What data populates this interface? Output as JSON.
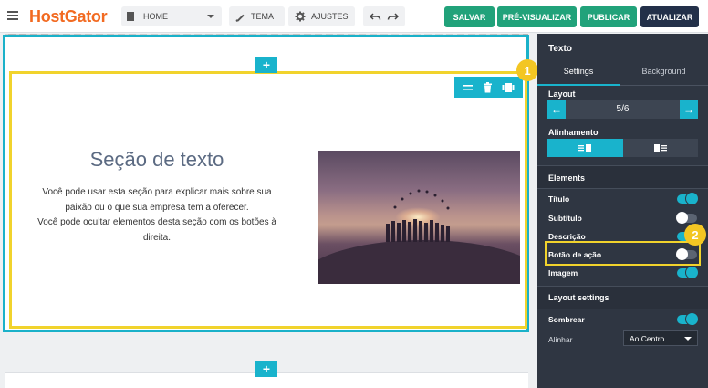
{
  "app": {
    "logo": "HostGator"
  },
  "topbar": {
    "page_select": "HOME",
    "tema_label": "TEMA",
    "ajustes_label": "AJUSTES",
    "salvar_label": "SALVAR",
    "previsualizar_label": "PRÉ-VISUALIZAR",
    "publicar_label": "PUBLICAR",
    "atualizar_label": "ATUALIZAR"
  },
  "section": {
    "title": "Seção de texto",
    "description": [
      "Você pode usar esta seção para explicar mais sobre sua",
      "paixão ou o que sua empresa tem a oferecer.",
      "Você pode ocultar elementos desta seção com os botões à",
      "direita."
    ],
    "add_symbol": "+"
  },
  "badges": {
    "one": "1",
    "two": "2"
  },
  "panel": {
    "title": "Texto",
    "tabs": [
      {
        "label": "Settings",
        "active": true
      },
      {
        "label": "Background",
        "active": false
      }
    ],
    "layout_label": "Layout",
    "layout_value": "5/6",
    "alignment_label": "Alinhamento",
    "elements_header": "Elements",
    "elements": [
      {
        "label": "Título",
        "on": true
      },
      {
        "label": "Subtítulo",
        "on": false
      },
      {
        "label": "Descrição",
        "on": true
      },
      {
        "label": "Botão de ação",
        "on": false
      },
      {
        "label": "Imagem",
        "on": true
      }
    ],
    "layout_settings_header": "Layout settings",
    "sombrear_label": "Sombrear",
    "sombrear_on": true,
    "alinhar_label": "Alinhar",
    "alinhar_value": "Ao Centro"
  },
  "colors": {
    "accent": "#19b3cc",
    "green": "#21a27a",
    "navy": "#233049",
    "highlight": "#f1d32c",
    "logo": "#f26a21"
  }
}
